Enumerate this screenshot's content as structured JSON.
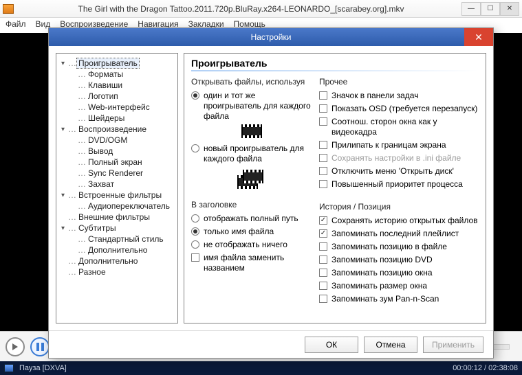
{
  "app": {
    "title": "The Girl with the Dragon Tattoo.2011.720p.BluRay.x264-LEONARDO_[scarabey.org].mkv",
    "menu": [
      "Файл",
      "Вид",
      "Воспроизведение",
      "Навигация",
      "Закладки",
      "Помощь"
    ],
    "status_left": "Пауза [DXVA]",
    "status_time": "00:00:12 / 02:38:08"
  },
  "dialog": {
    "title": "Настройки",
    "section": "Проигрыватель",
    "tree": [
      {
        "l": "Проигрыватель",
        "d": 0,
        "tw": "▾",
        "sel": true
      },
      {
        "l": "Форматы",
        "d": 1
      },
      {
        "l": "Клавиши",
        "d": 1
      },
      {
        "l": "Логотип",
        "d": 1
      },
      {
        "l": "Web-интерфейс",
        "d": 1
      },
      {
        "l": "Шейдеры",
        "d": 1
      },
      {
        "l": "Воспроизведение",
        "d": 0,
        "tw": "▾"
      },
      {
        "l": "DVD/OGM",
        "d": 1
      },
      {
        "l": "Вывод",
        "d": 1
      },
      {
        "l": "Полный экран",
        "d": 1
      },
      {
        "l": "Sync Renderer",
        "d": 1
      },
      {
        "l": "Захват",
        "d": 1
      },
      {
        "l": "Встроенные фильтры",
        "d": 0,
        "tw": "▾"
      },
      {
        "l": "Аудиопереключатель",
        "d": 1
      },
      {
        "l": "Внешние фильтры",
        "d": 0,
        "tw": ""
      },
      {
        "l": "Субтитры",
        "d": 0,
        "tw": "▾"
      },
      {
        "l": "Стандартный стиль",
        "d": 1
      },
      {
        "l": "Дополнительно",
        "d": 1
      },
      {
        "l": "Дополнительно",
        "d": 0,
        "tw": ""
      },
      {
        "l": "Разное",
        "d": 0,
        "tw": ""
      }
    ],
    "open_files": {
      "label": "Открывать файлы, используя",
      "opt_same": "один и тот же проигрыватель для каждого файла",
      "opt_new": "новый проигрыватель для каждого файла"
    },
    "title_section": {
      "label": "В заголовке",
      "opt_full": "отображать полный путь",
      "opt_name": "только имя файла",
      "opt_none": "не отображать ничего",
      "chk_replace": "имя файла заменить названием"
    },
    "other": {
      "label": "Прочее",
      "tray": "Значок в панели задач",
      "osd": "Показать OSD (требуется перезапуск)",
      "aspect": "Соотнош. сторон окна как у видеокадра",
      "snap": "Прилипать к границам экрана",
      "ini": "Сохранять настройки в .ini файле",
      "disc": "Отключить меню 'Открыть диск'",
      "prio": "Повышенный приоритет процесса"
    },
    "history": {
      "label": "История / Позиция",
      "hist": "Сохранять историю открытых файлов",
      "playlist": "Запоминать последний плейлист",
      "filepos": "Запоминать позицию в файле",
      "dvdpos": "Запоминать позицию DVD",
      "winpos": "Запоминать позицию окна",
      "winsize": "Запоминать размер окна",
      "zoom": "Запоминать зум Pan-n-Scan"
    },
    "buttons": {
      "ok": "ОК",
      "cancel": "Отмена",
      "apply": "Применить"
    }
  }
}
